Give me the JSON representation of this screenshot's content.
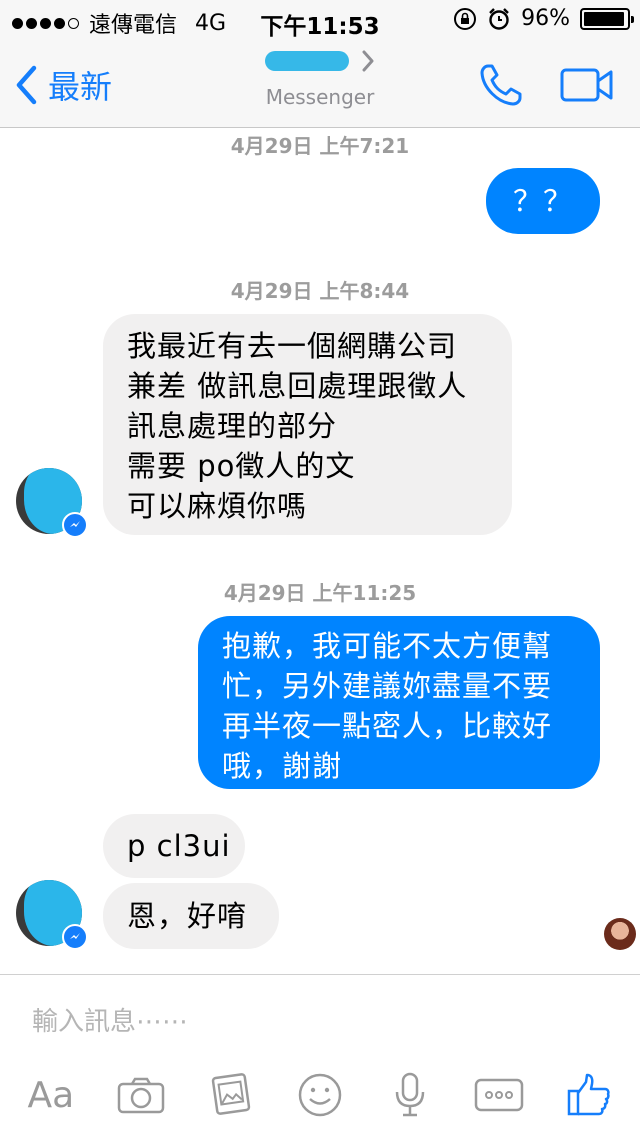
{
  "status_bar": {
    "carrier": "遠傳電信",
    "network": "4G",
    "time": "下午11:53",
    "battery": "96%",
    "battery_level": 0.96
  },
  "nav": {
    "back_label": "最新",
    "subtitle": "Messenger"
  },
  "messages": [
    {
      "type": "timestamp",
      "text": "4月29日 上午7:21"
    },
    {
      "type": "outgoing",
      "lines": [
        "？？"
      ]
    },
    {
      "type": "timestamp",
      "text": "4月29日 上午8:44"
    },
    {
      "type": "incoming",
      "lines": [
        "我最近有去一個網購公司",
        "兼差 做訊息回處理跟徵人",
        "訊息處理的部分",
        "需要 po徵人的文",
        "可以麻煩你嗎"
      ]
    },
    {
      "type": "timestamp",
      "text": "4月29日 上午11:25"
    },
    {
      "type": "outgoing",
      "lines": [
        "抱歉，我可能不太方便幫",
        "忙，另外建議妳盡量不要",
        "再半夜一點密人，比較好",
        "哦，謝謝"
      ]
    },
    {
      "type": "incoming",
      "lines": [
        "p cl3ui"
      ]
    },
    {
      "type": "incoming",
      "lines": [
        "恩，好唷"
      ]
    }
  ],
  "input": {
    "placeholder": "輸入訊息⋯⋯"
  },
  "toolbar": {
    "text_label": "Aa",
    "icons": [
      "text-format-icon",
      "camera-icon",
      "photo-icon",
      "emoji-icon",
      "microphone-icon",
      "more-icon",
      "like-icon"
    ]
  },
  "colors": {
    "accent": "#157efb",
    "outgoing_bubble": "#0084ff",
    "incoming_bubble": "#f1f0f0"
  }
}
